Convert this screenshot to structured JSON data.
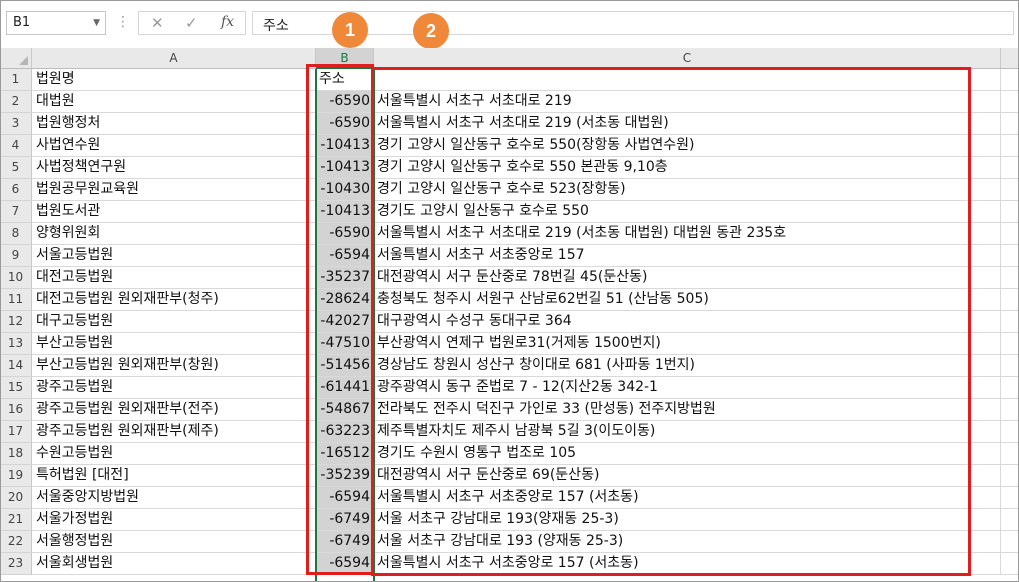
{
  "formula_bar": {
    "name_box": "B1",
    "separator": "⋮",
    "cancel_icon": "✕",
    "enter_icon": "✓",
    "fx_label": "fx",
    "formula": "주소"
  },
  "badges": [
    "1",
    "2"
  ],
  "columns": [
    {
      "label": "A"
    },
    {
      "label": "B"
    },
    {
      "label": "C"
    }
  ],
  "rows": [
    {
      "num": "1",
      "a": "법원명",
      "b": "주소",
      "c": ""
    },
    {
      "num": "2",
      "a": "대법원",
      "b": "-6590",
      "c": "서울특별시 서초구 서초대로 219"
    },
    {
      "num": "3",
      "a": "법원행정처",
      "b": "-6590",
      "c": "서울특별시 서초구 서초대로 219 (서초동 대법원)"
    },
    {
      "num": "4",
      "a": "사법연수원",
      "b": "-10413",
      "c": "경기 고양시 일산동구 호수로 550(장항동 사법연수원)"
    },
    {
      "num": "5",
      "a": "사법정책연구원",
      "b": "-10413",
      "c": "경기 고양시 일산동구 호수로 550 본관동 9,10층"
    },
    {
      "num": "6",
      "a": "법원공무원교육원",
      "b": "-10430",
      "c": "경기 고양시 일산동구 호수로 523(장항동)"
    },
    {
      "num": "7",
      "a": "법원도서관",
      "b": "-10413",
      "c": "경기도 고양시 일산동구 호수로 550"
    },
    {
      "num": "8",
      "a": "양형위원회",
      "b": "-6590",
      "c": "서울특별시 서초구 서초대로 219 (서초동 대법원) 대법원 동관 235호"
    },
    {
      "num": "9",
      "a": "서울고등법원",
      "b": "-6594",
      "c": "서울특별시 서초구 서초중앙로 157"
    },
    {
      "num": "10",
      "a": "대전고등법원",
      "b": "-35237",
      "c": "대전광역시 서구 둔산중로 78번길 45(둔산동)"
    },
    {
      "num": "11",
      "a": "대전고등법원 원외재판부(청주)",
      "b": "-28624",
      "c": "충청북도 청주시 서원구 산남로62번길 51 (산남동 505)"
    },
    {
      "num": "12",
      "a": "대구고등법원",
      "b": "-42027",
      "c": "대구광역시 수성구 동대구로 364"
    },
    {
      "num": "13",
      "a": "부산고등법원",
      "b": "-47510",
      "c": "부산광역시 연제구 법원로31(거제동 1500번지)"
    },
    {
      "num": "14",
      "a": "부산고등법원 원외재판부(창원)",
      "b": "-51456",
      "c": "경상남도 창원시 성산구 창이대로 681 (사파동 1번지)"
    },
    {
      "num": "15",
      "a": "광주고등법원",
      "b": "-61441",
      "c": "광주광역시 동구 준법로 7 - 12(지산2동 342-1"
    },
    {
      "num": "16",
      "a": "광주고등법원 원외재판부(전주)",
      "b": "-54867",
      "c": "전라북도 전주시 덕진구 가인로 33 (만성동) 전주지방법원"
    },
    {
      "num": "17",
      "a": "광주고등법원 원외재판부(제주)",
      "b": "-63223",
      "c": "제주특별자치도 제주시 남광북 5길 3(이도이동)"
    },
    {
      "num": "18",
      "a": "수원고등법원",
      "b": "-16512",
      "c": "경기도 수원시 영통구 법조로 105"
    },
    {
      "num": "19",
      "a": "특허법원 [대전]",
      "b": "-35239",
      "c": "대전광역시 서구 둔산중로 69(둔산동)"
    },
    {
      "num": "20",
      "a": "서울중앙지방법원",
      "b": "-6594",
      "c": "서울특별시 서초구 서초중앙로 157 (서초동)"
    },
    {
      "num": "21",
      "a": "서울가정법원",
      "b": "-6749",
      "c": "서울 서초구 강남대로 193(양재동 25-3)"
    },
    {
      "num": "22",
      "a": "서울행정법원",
      "b": "-6749",
      "c": "서울 서초구 강남대로 193 (양재동 25-3)"
    },
    {
      "num": "23",
      "a": "서울회생법원",
      "b": "-6594",
      "c": "서울특별시 서초구 서초중앙로 157 (서초동)"
    }
  ],
  "colors": {
    "selection": "#217346",
    "highlight": "#e11d1d",
    "badge": "#f0883a"
  }
}
